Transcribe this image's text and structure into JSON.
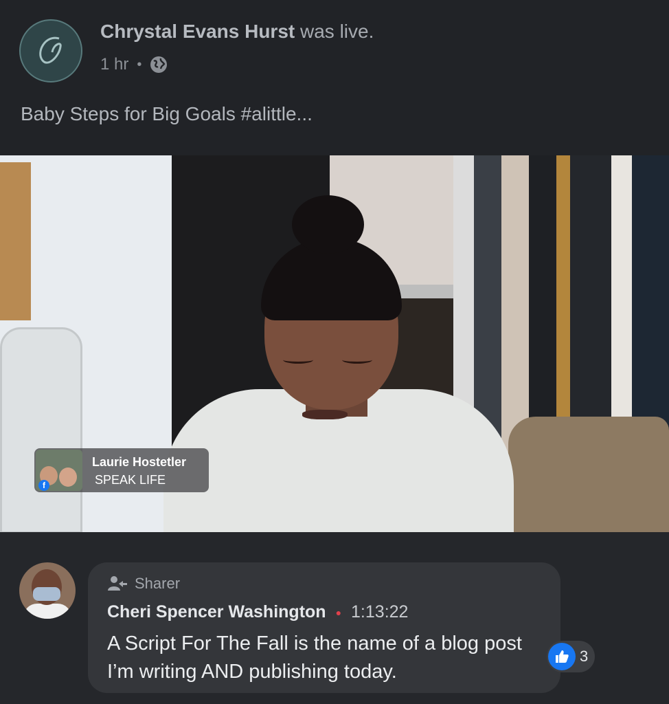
{
  "post": {
    "author": "Chrystal Evans Hurst",
    "status": "was live.",
    "time": "1 hr",
    "privacy_icon": "globe-icon",
    "text": "Baby Steps for Big Goals #alittle..."
  },
  "video": {
    "overlay": {
      "name": "Laurie Hostetler",
      "subtitle": "SPEAK LIFE",
      "badge_icon": "facebook-icon"
    }
  },
  "comment": {
    "badge_icon": "sharer-icon",
    "badge_label": "Sharer",
    "name": "Cheri Spencer Washington",
    "time": "1:13:22",
    "text": "A Script For The Fall is the name of a blog post I’m writing AND publishing today.",
    "reaction_icon": "like-icon",
    "reaction_count": "3"
  },
  "colors": {
    "background": "#1f2125",
    "bubble": "#34363a",
    "like_blue": "#1877f2",
    "live_dot": "#e0414c"
  }
}
